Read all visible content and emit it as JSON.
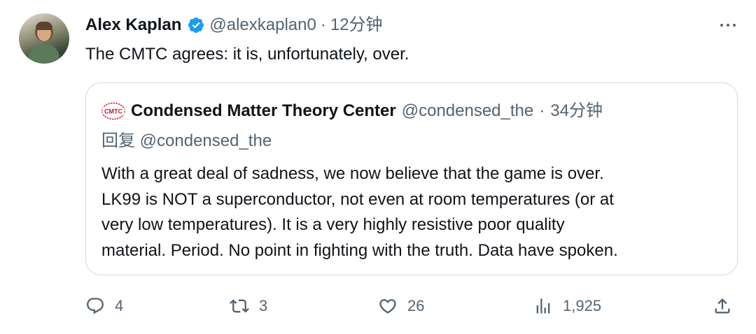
{
  "author": {
    "name": "Alex Kaplan",
    "handle": "@alexkaplan0",
    "separator": "·",
    "time": "12分钟"
  },
  "tweet": {
    "text": "The CMTC agrees: it is, unfortunately, over."
  },
  "quoted": {
    "logo_text": "CMTC",
    "name": "Condensed Matter Theory Center",
    "handle": "@condensed_the",
    "separator": "·",
    "time": "34分钟",
    "reply_to": "回复 @condensed_the",
    "lines": [
      "With a great deal of sadness, we now believe that the game is over.",
      "LK99 is NOT a superconductor, not even at room temperatures (or at",
      "very low temperatures).  It is a very highly resistive poor quality",
      "material.  Period. No point in fighting with the truth.  Data have spoken."
    ]
  },
  "actions": {
    "replies": "4",
    "retweets": "3",
    "likes": "26",
    "views": "1,925"
  },
  "colors": {
    "text": "#0f1419",
    "secondary": "#536471",
    "border": "#cfd9de",
    "verified": "#1d9bf0",
    "logo_red": "#c8102e"
  }
}
